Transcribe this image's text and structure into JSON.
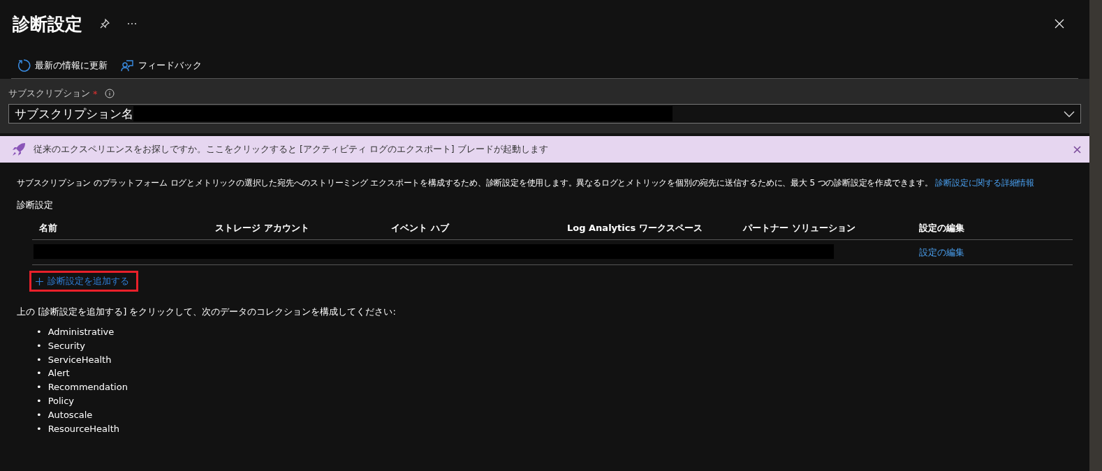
{
  "header": {
    "title": "診断設定"
  },
  "toolbar": [
    {
      "kind": "refresh",
      "label": "最新の情報に更新"
    },
    {
      "kind": "feedback",
      "label": "フィードバック"
    }
  ],
  "subscription": {
    "label": "サブスクリプション",
    "required_mark": "*",
    "value": "サブスクリプション名"
  },
  "banner": {
    "text": "従来のエクスペリエンスをお探しですか。ここをクリックすると [アクティビティ ログのエクスポート] ブレードが起動します"
  },
  "description": {
    "text": "サブスクリプション のプラットフォーム ログとメトリックの選択した宛先へのストリーミング エクスポートを構成するため、診断設定を使用します。異なるログとメトリックを個別の宛先に送信するために、最大 5 つの診断設定を作成できます。",
    "link": "診断設定に関する詳細情報"
  },
  "section_title": "診断設定",
  "table": {
    "columns": [
      "名前",
      "ストレージ アカウント",
      "イベント ハブ",
      "Log Analytics ワークスペース",
      "パートナー ソリューション",
      "設定の編集"
    ],
    "rows": [
      {
        "edit_link": "設定の編集"
      }
    ]
  },
  "add_button": {
    "label": "診断設定を追加する",
    "highlighted": true
  },
  "instructions": "上の [診断設定を追加する] をクリックして、次のデータのコレクションを構成してください:",
  "bullet": "•",
  "categories": [
    "Administrative",
    "Security",
    "ServiceHealth",
    "Alert",
    "Recommendation",
    "Policy",
    "Autoscale",
    "ResourceHealth"
  ]
}
